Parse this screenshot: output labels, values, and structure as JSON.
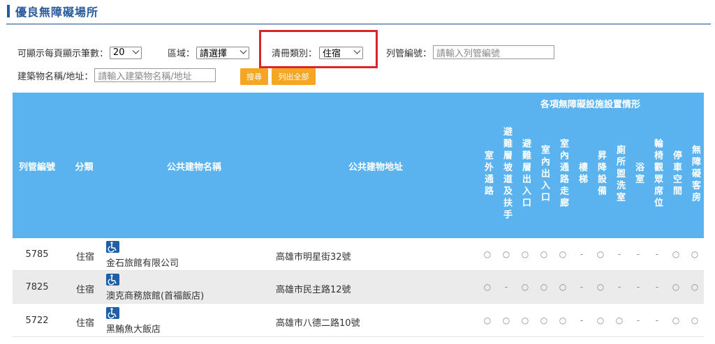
{
  "page": {
    "title": "優良無障礙場所"
  },
  "filters": {
    "per_page_label": "可顯示每頁顯示筆數：",
    "per_page_value": "20",
    "district_label": "區域：",
    "district_value": "請選擇",
    "category_label": "清冊類別：",
    "category_value": "住宿",
    "serial_label": "列管編號：",
    "serial_placeholder": "請輸入列管編號",
    "name_label": "建築物名稱/地址：",
    "name_placeholder": "請輸入建築物名稱/地址",
    "search_button": "搜尋",
    "list_all_button": "列出全部"
  },
  "table": {
    "headers": {
      "serial": "列管編號",
      "category": "分類",
      "name": "公共建物名稱",
      "address": "公共建物地址",
      "facilities_group": "各項無障礙設施設置情形"
    },
    "facility_columns": [
      "室外通路",
      "避難層坡道及扶手",
      "避難層出入口",
      "室內出入口",
      "室內通路走廊",
      "樓梯",
      "昇降設備",
      "廁所盥洗室",
      "浴室",
      "輪椅觀眾席位",
      "停車空間",
      "無障礙客房"
    ],
    "rows": [
      {
        "serial": "5785",
        "category": "住宿",
        "name": "金石旅館有限公司",
        "address": "高雄市明星街32號",
        "marks": [
          "○",
          "○",
          "○",
          "○",
          "○",
          "-",
          "○",
          "-",
          "-",
          "-",
          "○",
          "○"
        ]
      },
      {
        "serial": "7825",
        "category": "住宿",
        "name": "澳克商務旅館(首福飯店)",
        "address": "高雄市民主路12號",
        "marks": [
          "○",
          "-",
          "○",
          "○",
          "○",
          "-",
          "○",
          "-",
          "-",
          "-",
          "○",
          "○"
        ]
      },
      {
        "serial": "5722",
        "category": "住宿",
        "name": "黑鮪魚大飯店",
        "address": "高雄市八德二路10號",
        "marks": [
          "○",
          "○",
          "○",
          "○",
          "○",
          "-",
          "○",
          "○",
          "-",
          "-",
          "○",
          "○"
        ]
      }
    ]
  },
  "colors": {
    "header_bg": "#5ab3ef",
    "title": "#2a5a9e",
    "button": "#f5a623",
    "highlight": "#d9262c",
    "accessible_icon": "#1f5fa8"
  },
  "icons": {
    "accessible": "wheelchair-icon"
  }
}
